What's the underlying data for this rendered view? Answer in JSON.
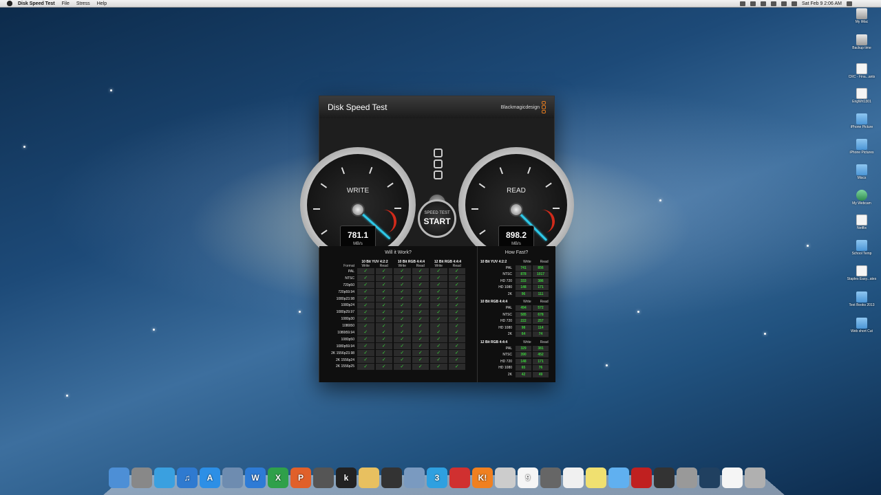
{
  "menubar": {
    "app_name": "Disk Speed Test",
    "menus": [
      "File",
      "Stress",
      "Help"
    ],
    "clock": "Sat Feb 9  2:06 AM"
  },
  "desktop_icons": [
    {
      "label": "My iMac",
      "icon": "drive-icon"
    },
    {
      "label": "Backup time",
      "icon": "drive-icon"
    },
    {
      "label": "CRC - Fina...ants",
      "icon": "document-icon"
    },
    {
      "label": "EngWrt1301",
      "icon": "document-icon"
    },
    {
      "label": "iPhone Picture",
      "icon": "folder-icon"
    },
    {
      "label": "iPhone Pictures",
      "icon": "folder-icon"
    },
    {
      "label": "Miscs",
      "icon": "folder-icon"
    },
    {
      "label": "My Webcam",
      "icon": "app-icon"
    },
    {
      "label": "Netflix",
      "icon": "document-icon"
    },
    {
      "label": "School Temp",
      "icon": "folder-icon"
    },
    {
      "label": "Staples Easy...ates",
      "icon": "document-icon"
    },
    {
      "label": "Text Books 2013",
      "icon": "folder-icon"
    },
    {
      "label": "Web short Cut",
      "icon": "folder-icon"
    }
  ],
  "window": {
    "title": "Disk Speed Test",
    "brand": "Blackmagicdesign",
    "write_gauge": {
      "label": "WRITE",
      "value": "781.1",
      "unit": "MB/s"
    },
    "read_gauge": {
      "label": "READ",
      "value": "898.2",
      "unit": "MB/s"
    },
    "start_button": {
      "line1": "SPEED TEST",
      "line2": "START"
    },
    "will_it_work": {
      "title": "Will it Work?",
      "groups": [
        "10 Bit YUV 4:2:2",
        "10 Bit RGB 4:4:4",
        "12 Bit RGB 4:4:4"
      ],
      "format_header": "Format",
      "write_label": "Write",
      "read_label": "Read",
      "check": "✓",
      "formats": [
        "PAL",
        "NTSC",
        "720p50",
        "720p59.94",
        "1080p23.98",
        "1080p24",
        "1080p29.97",
        "1080p30",
        "1080i50",
        "1080i59.94",
        "1080p50",
        "1080p59.94",
        "2K 1556p23.98",
        "2K 1556p24",
        "2K 1556p25"
      ]
    },
    "how_fast": {
      "title": "How Fast?",
      "write_label": "Write",
      "read_label": "Read",
      "sections": [
        {
          "name": "10 Bit YUV 4:2:2",
          "rows": [
            {
              "format": "PAL",
              "write": "741",
              "read": "856"
            },
            {
              "format": "NTSC",
              "write": "878",
              "read": "1017"
            },
            {
              "format": "HD 720",
              "write": "333",
              "read": "386"
            },
            {
              "format": "HD 1080",
              "write": "148",
              "read": "171"
            },
            {
              "format": "2K",
              "write": "96",
              "read": "111"
            }
          ]
        },
        {
          "name": "10 Bit RGB 4:4:4",
          "rows": [
            {
              "format": "PAL",
              "write": "494",
              "read": "572"
            },
            {
              "format": "NTSC",
              "write": "585",
              "read": "678"
            },
            {
              "format": "HD 720",
              "write": "222",
              "read": "257"
            },
            {
              "format": "HD 1080",
              "write": "98",
              "read": "114"
            },
            {
              "format": "2K",
              "write": "64",
              "read": "74"
            }
          ]
        },
        {
          "name": "12 Bit RGB 4:4:4",
          "rows": [
            {
              "format": "PAL",
              "write": "329",
              "read": "381"
            },
            {
              "format": "NTSC",
              "write": "390",
              "read": "452"
            },
            {
              "format": "HD 720",
              "write": "148",
              "read": "171"
            },
            {
              "format": "HD 1080",
              "write": "65",
              "read": "76"
            },
            {
              "format": "2K",
              "write": "42",
              "read": "49"
            }
          ]
        }
      ]
    }
  },
  "dock": {
    "items": [
      {
        "name": "finder-icon",
        "color": "#4d8fd6",
        "glyph": ""
      },
      {
        "name": "launchpad-icon",
        "color": "#888888",
        "glyph": ""
      },
      {
        "name": "safari-icon",
        "color": "#3aa0e0",
        "glyph": ""
      },
      {
        "name": "itunes-icon",
        "color": "#2f7ad0",
        "glyph": "♫"
      },
      {
        "name": "app-store-icon",
        "color": "#2c8fe6",
        "glyph": "A"
      },
      {
        "name": "preview-icon",
        "color": "#6e8cb0",
        "glyph": ""
      },
      {
        "name": "word-icon",
        "color": "#2e7bd6",
        "glyph": "W"
      },
      {
        "name": "excel-icon",
        "color": "#2fa04a",
        "glyph": "X"
      },
      {
        "name": "powerpoint-icon",
        "color": "#e0602a",
        "glyph": "P"
      },
      {
        "name": "calculator-icon",
        "color": "#555555",
        "glyph": ""
      },
      {
        "name": "kindle-icon",
        "color": "#222222",
        "glyph": "k"
      },
      {
        "name": "notes-icon",
        "color": "#e8c060",
        "glyph": ""
      },
      {
        "name": "aperture-icon",
        "color": "#333333",
        "glyph": ""
      },
      {
        "name": "iphoto-icon",
        "color": "#7a9ac0",
        "glyph": ""
      },
      {
        "name": "3-icon",
        "color": "#2fa0e0",
        "glyph": "3"
      },
      {
        "name": "english-icon",
        "color": "#d03030",
        "glyph": ""
      },
      {
        "name": "k1-icon",
        "color": "#f08020",
        "glyph": "K!"
      },
      {
        "name": "facetime-icon",
        "color": "#cccccc",
        "glyph": ""
      },
      {
        "name": "calendar-icon",
        "color": "#f5f5f5",
        "glyph": "9"
      },
      {
        "name": "dashboard-icon",
        "color": "#666666",
        "glyph": ""
      },
      {
        "name": "textedit-icon",
        "color": "#f0f0f0",
        "glyph": ""
      },
      {
        "name": "stickies-icon",
        "color": "#f0e070",
        "glyph": ""
      },
      {
        "name": "messages-icon",
        "color": "#60b0f0",
        "glyph": ""
      },
      {
        "name": "photobooth-icon",
        "color": "#c02020",
        "glyph": ""
      },
      {
        "name": "activity-monitor-icon",
        "color": "#333333",
        "glyph": ""
      },
      {
        "name": "system-preferences-icon",
        "color": "#999999",
        "glyph": ""
      },
      {
        "name": "time-machine-icon",
        "color": "#204060",
        "glyph": ""
      },
      {
        "name": "document-icon",
        "color": "#f5f5f5",
        "glyph": ""
      },
      {
        "name": "trash-icon",
        "color": "#b0b0b0",
        "glyph": ""
      }
    ]
  }
}
